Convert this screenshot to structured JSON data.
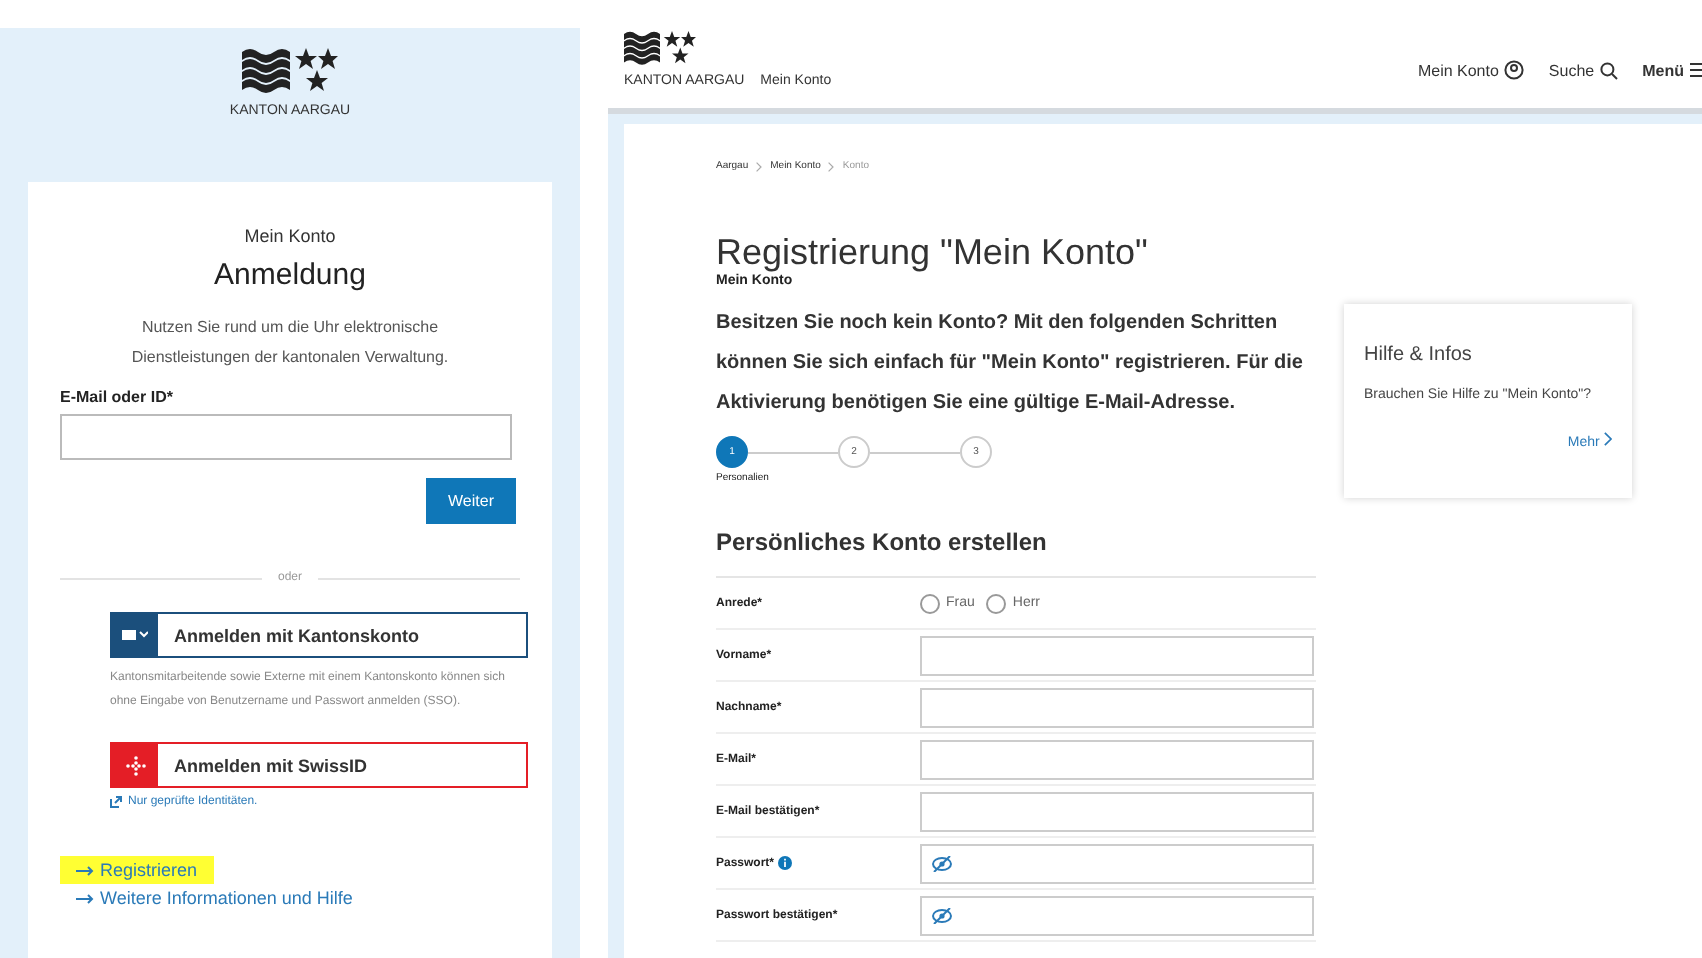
{
  "login": {
    "logo_text": "KANTON AARGAU",
    "subtitle": "Mein Konto",
    "title": "Anmeldung",
    "intro": "Nutzen Sie rund um die Uhr elektronische Dienstleistungen der kantonalen Verwaltung.",
    "email_label": "E-Mail oder ID*",
    "next_button": "Weiter",
    "divider": "oder",
    "sso_buttons": [
      {
        "kind": "kanton",
        "label": "Anmelden mit Kantonskonto",
        "note": "Kantonsmitarbeitende sowie Externe mit einem Kantonskonto können sich ohne Eingabe von Benutzername und Passwort anmelden (SSO)."
      },
      {
        "kind": "swissid",
        "label": "Anmelden mit SwissID",
        "note": "Nur geprüfte Identitäten."
      }
    ],
    "links": [
      {
        "label": "Registrieren",
        "highlighted": true
      },
      {
        "label": "Weitere Informationen und Hilfe",
        "highlighted": false
      }
    ]
  },
  "register": {
    "logo_text": "KANTON AARGAU",
    "site_name": "Mein Konto",
    "nav": [
      {
        "label": "Mein Konto",
        "kind": "account"
      },
      {
        "label": "Suche",
        "kind": "search"
      },
      {
        "label": "Menü",
        "kind": "menu"
      }
    ],
    "breadcrumb": [
      "Aargau",
      "Mein Konto",
      "Konto"
    ],
    "title": "Registrierung \"Mein Konto\"",
    "subtitle": "Mein Konto",
    "intro": "Besitzen Sie noch kein Konto? Mit den folgenden Schritten können Sie sich einfach für \"Mein Konto\" registrieren. Für die Aktivierung benötigen Sie eine gültige E-Mail-Adresse.",
    "steps": [
      {
        "number": "1",
        "label": "Personalien",
        "selected": true
      },
      {
        "number": "2",
        "selected": false
      },
      {
        "number": "3",
        "selected": false
      }
    ],
    "help": {
      "title": "Hilfe & Infos",
      "text": "Brauchen Sie Hilfe zu \"Mein Konto\"?",
      "link": "Mehr"
    },
    "form_title": "Persönliches Konto erstellen",
    "fields": [
      {
        "kind": "radio",
        "label": "Anrede*",
        "options": [
          {
            "label": "Frau",
            "selected": false
          },
          {
            "label": "Herr",
            "selected": false
          }
        ]
      },
      {
        "kind": "text",
        "label": "Vorname*"
      },
      {
        "kind": "text",
        "label": "Nachname*"
      },
      {
        "kind": "text",
        "label": "E-Mail*"
      },
      {
        "kind": "text",
        "label": "E-Mail bestätigen*"
      },
      {
        "kind": "password",
        "label": "Passwort*",
        "info": true
      },
      {
        "kind": "password",
        "label": "Passwort bestätigen*",
        "info": false
      }
    ]
  }
}
